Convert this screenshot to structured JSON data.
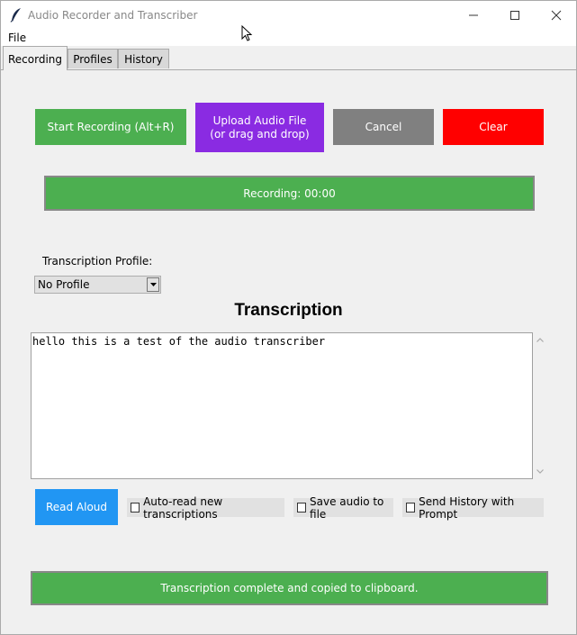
{
  "window": {
    "title": "Audio Recorder and Transcriber",
    "controls": [
      "minimize-icon",
      "maximize-icon",
      "close-icon"
    ]
  },
  "menu": {
    "items": [
      "File"
    ]
  },
  "tabs": [
    {
      "label": "Recording",
      "active": true
    },
    {
      "label": "Profiles",
      "active": false
    },
    {
      "label": "History",
      "active": false
    }
  ],
  "recording": {
    "start_label": "Start Recording (Alt+R)",
    "upload_line1": "Upload Audio File",
    "upload_line2": "(or drag and drop)",
    "cancel_label": "Cancel",
    "clear_label": "Clear",
    "status": "Recording: 00:00"
  },
  "profile": {
    "label": "Transcription Profile:",
    "selected": "No Profile"
  },
  "transcription": {
    "heading": "Transcription",
    "text": "hello this is a test of the audio transcriber"
  },
  "controls": {
    "read_aloud_label": "Read Aloud",
    "auto_read_label": "Auto-read new transcriptions",
    "auto_read_checked": false,
    "save_audio_label": "Save audio to file",
    "save_audio_checked": false,
    "send_history_label": "Send History with Prompt",
    "send_history_checked": false
  },
  "footer": {
    "status": "Transcription complete and copied to clipboard."
  },
  "colors": {
    "green": "#4caf50",
    "purple": "#8a2be2",
    "gray": "#808080",
    "red": "#ff0000",
    "blue": "#2196f3"
  }
}
